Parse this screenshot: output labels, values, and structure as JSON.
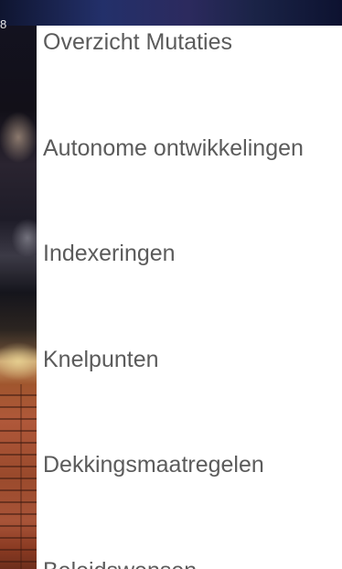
{
  "background": {
    "corner_text": "8"
  },
  "drawer": {
    "items": [
      {
        "label": "Overzicht Mutaties"
      },
      {
        "label": "Autonome ontwikkelingen"
      },
      {
        "label": "Indexeringen"
      },
      {
        "label": "Knelpunten"
      },
      {
        "label": "Dekkingsmaatregelen"
      },
      {
        "label": "Beleidswensen"
      }
    ]
  },
  "colors": {
    "menu_text": "#5b5b5b",
    "drawer_background": "#ffffff"
  }
}
